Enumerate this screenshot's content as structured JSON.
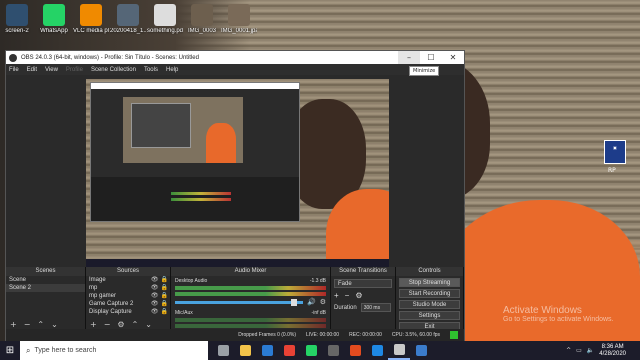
{
  "desktop": {
    "icons": [
      {
        "label": "screen-2",
        "color": "#2f4f6f"
      },
      {
        "label": "WhatsApp",
        "color": "#25d366"
      },
      {
        "label": "VLC media player",
        "color": "#f08a00"
      },
      {
        "label": "20200418_1...",
        "color": "#556677"
      },
      {
        "label": "something.pdf",
        "color": "#dddddd"
      },
      {
        "label": "IMG_0003",
        "color": "#6d5f4e"
      },
      {
        "label": "IMG_0001.jpa",
        "color": "#7a6a58"
      }
    ],
    "right_icon_label": "RP",
    "activate_title": "Activate Windows",
    "activate_sub": "Go to Settings to activate Windows."
  },
  "obs": {
    "title": "OBS 24.0.3 (64-bit, windows) - Profile: Sin Título - Scenes: Untitled",
    "tooltip": "Minimize",
    "menu": [
      "File",
      "Edit",
      "View",
      "Profile",
      "Scene Collection",
      "Tools",
      "Help"
    ],
    "scenes": {
      "header": "Scenes",
      "items": [
        "Scene",
        "Scene 2"
      ]
    },
    "sources": {
      "header": "Sources",
      "items": [
        "Image",
        "mp",
        "mp gamer",
        "Game Capture 2",
        "Display Capture"
      ]
    },
    "mixer": {
      "header": "Audio Mixer",
      "channels": [
        {
          "name": "Desktop Audio",
          "db": "-1.3 dB"
        },
        {
          "name": "Mic/Aux",
          "db": "-inf dB"
        }
      ]
    },
    "transitions": {
      "header": "Scene Transitions",
      "selected": "Fade",
      "duration_label": "Duration",
      "duration_value": "300 ms"
    },
    "controls": {
      "header": "Controls",
      "buttons": [
        "Stop Streaming",
        "Start Recording",
        "Studio Mode",
        "Settings",
        "Exit"
      ]
    },
    "status": {
      "dropped": "Dropped Frames 0 (0.0%)",
      "live": "LIVE: 00:00:00",
      "rec": "REC: 00:00:00",
      "cpu": "CPU: 3.5%, 60.00 fps"
    }
  },
  "taskbar": {
    "search_placeholder": "Type here to search",
    "apps": [
      {
        "name": "task-view",
        "color": "#9aa0a6"
      },
      {
        "name": "file-explorer",
        "color": "#f3c34a"
      },
      {
        "name": "store",
        "color": "#2b7bd4"
      },
      {
        "name": "chrome",
        "color": "#e84235"
      },
      {
        "name": "whatsapp",
        "color": "#25d366"
      },
      {
        "name": "camera",
        "color": "#666666"
      },
      {
        "name": "adobe",
        "color": "#e34b1f"
      },
      {
        "name": "edge",
        "color": "#1e88e5"
      },
      {
        "name": "obs",
        "color": "#c9c9c9"
      },
      {
        "name": "screen",
        "color": "#3b7ccc"
      }
    ],
    "time": "8:36 AM",
    "date": "4/28/2020"
  }
}
